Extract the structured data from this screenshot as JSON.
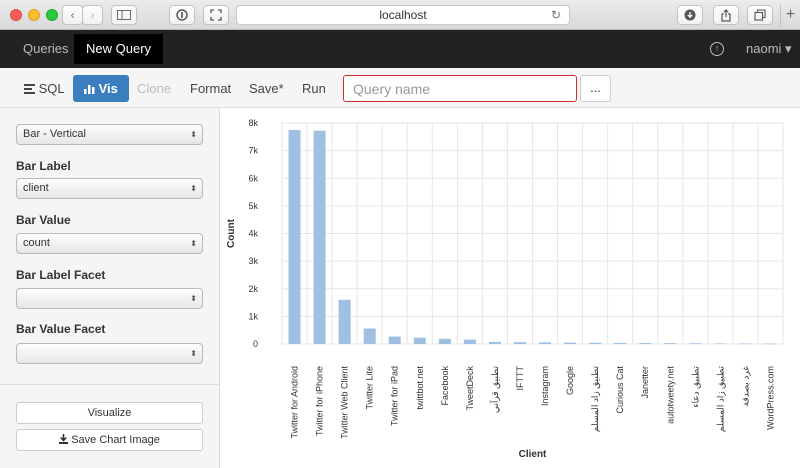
{
  "browser": {
    "url": "localhost"
  },
  "navbar": {
    "tabs": [
      {
        "label": "Queries"
      },
      {
        "label": "New Query"
      }
    ],
    "user": "naomi ▾"
  },
  "toolbar": {
    "sql": "SQL",
    "vis": "Vis",
    "clone": "Clone",
    "format": "Format",
    "save": "Save*",
    "run": "Run",
    "query_placeholder": "Query name",
    "more": "..."
  },
  "sidebar": {
    "chart_type": "Bar - Vertical",
    "bar_label_title": "Bar Label",
    "bar_label_value": "client",
    "bar_value_title": "Bar Value",
    "bar_value_value": "count",
    "label_facet_title": "Bar Label Facet",
    "label_facet_value": "",
    "value_facet_title": "Bar Value Facet",
    "value_facet_value": "",
    "visualize": "Visualize",
    "save_image": "Save Chart Image"
  },
  "colors": {
    "bar": "#9fbfe3",
    "accent": "#3a7ebf"
  },
  "chart_data": {
    "type": "bar",
    "xlabel": "Client",
    "ylabel": "Count",
    "ylim": [
      0,
      8000
    ],
    "yticks": [
      0,
      1000,
      2000,
      3000,
      4000,
      5000,
      6000,
      7000,
      8000
    ],
    "ytick_labels": [
      "0",
      "1k",
      "2k",
      "3k",
      "4k",
      "5k",
      "6k",
      "7k",
      "8k"
    ],
    "grid": true,
    "categories": [
      "Twitter for Android",
      "Twitter for iPhone",
      "Twitter Web Client",
      "Twitter Lite",
      "Twitter for iPad",
      "twittbot.net",
      "Facebook",
      "TweetDeck",
      "تطبيق قرآني",
      "IFTTT",
      "Instagram",
      "Google",
      "تطبيق زاد المسلم",
      "Curious Cat",
      "Janetter",
      "autotweety.net",
      "تطبيق دعاء",
      "تطبيق زاد المسلم",
      "غرد بصدقة",
      "WordPress.com"
    ],
    "values": [
      7750,
      7720,
      1600,
      560,
      270,
      230,
      190,
      160,
      75,
      65,
      60,
      50,
      45,
      40,
      35,
      30,
      25,
      20,
      18,
      15
    ]
  }
}
